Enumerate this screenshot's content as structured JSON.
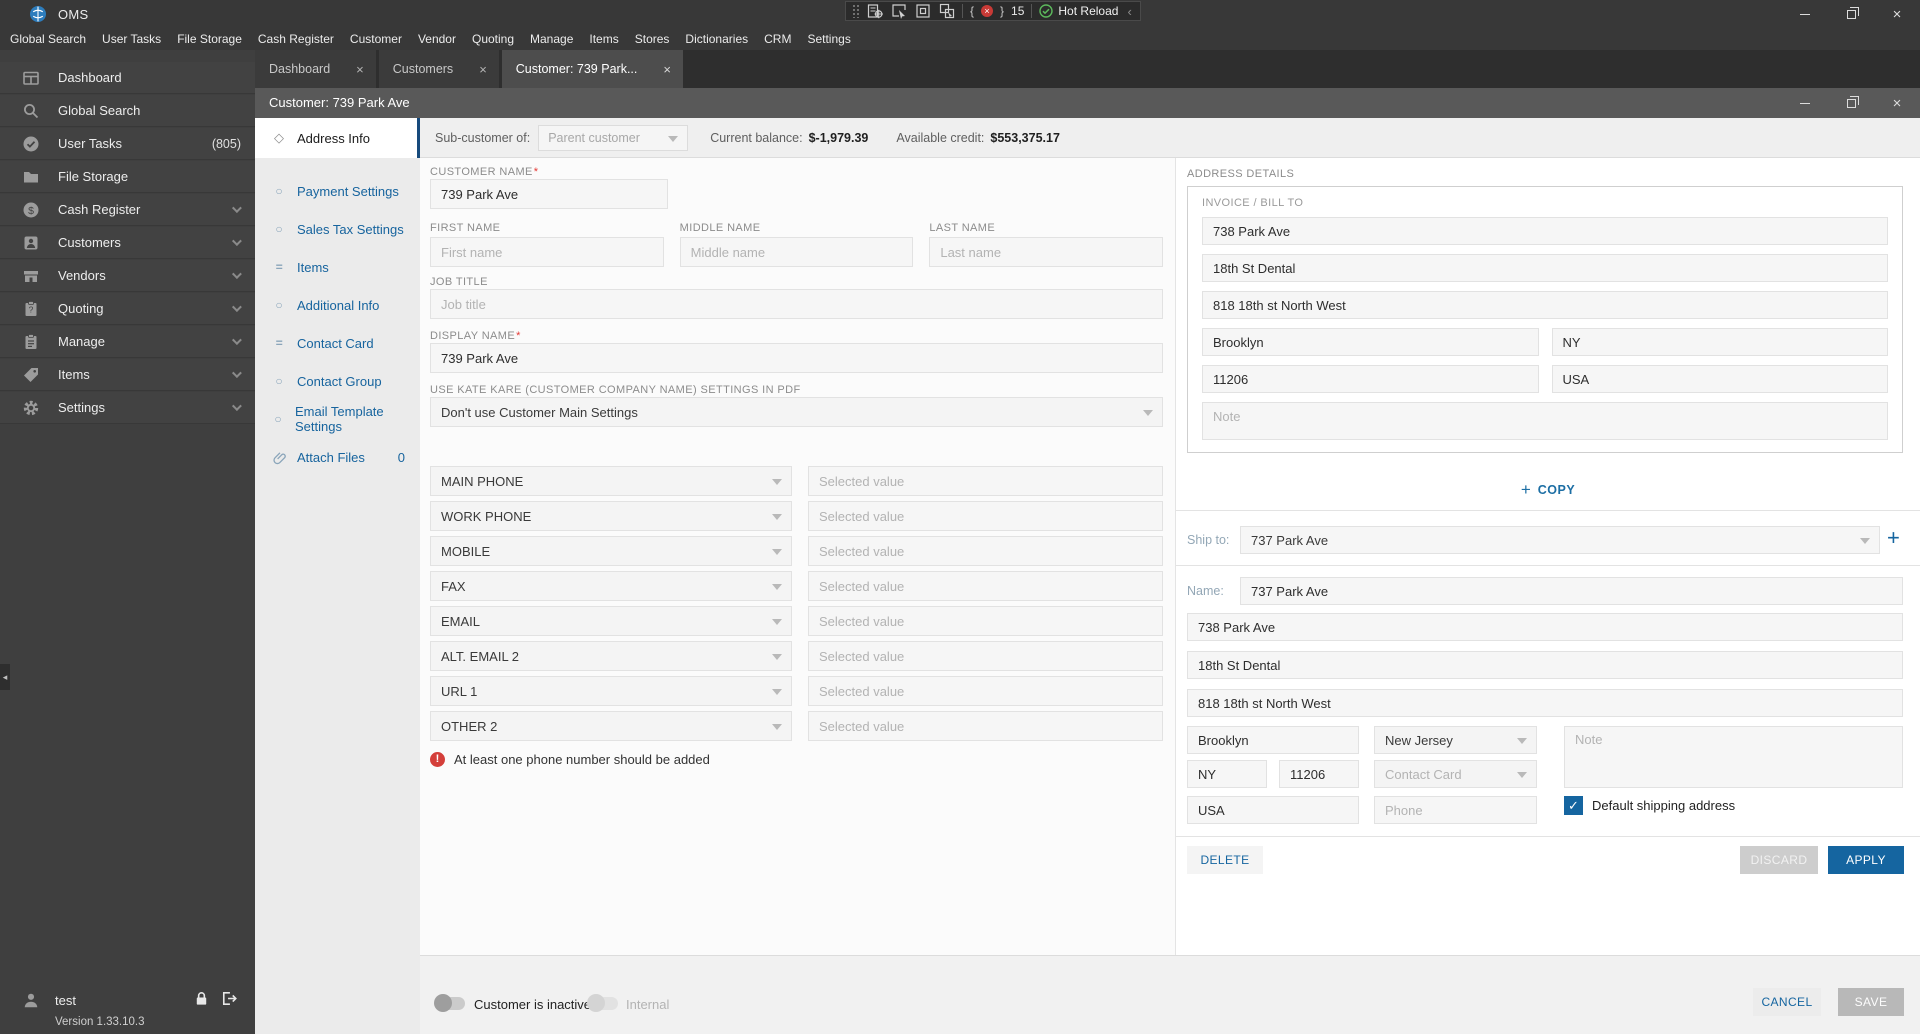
{
  "app": {
    "name": "OMS"
  },
  "debug_overlay": {
    "binding_count": "15",
    "hot_reload_label": "Hot Reload"
  },
  "menubar": {
    "items": [
      "Global Search",
      "User Tasks",
      "File Storage",
      "Cash Register",
      "Customer",
      "Vendor",
      "Quoting",
      "Manage",
      "Items",
      "Stores",
      "Dictionaries",
      "CRM",
      "Settings"
    ]
  },
  "sidebar": {
    "items": [
      {
        "label": "Dashboard"
      },
      {
        "label": "Global Search"
      },
      {
        "label": "User Tasks",
        "badge": "(805)"
      },
      {
        "label": "File Storage"
      },
      {
        "label": "Cash Register"
      },
      {
        "label": "Customers"
      },
      {
        "label": "Vendors"
      },
      {
        "label": "Quoting"
      },
      {
        "label": "Manage"
      },
      {
        "label": "Items"
      },
      {
        "label": "Settings"
      }
    ],
    "user": "test",
    "version": "Version 1.33.10.3"
  },
  "tabs": {
    "items": [
      {
        "label": "Dashboard"
      },
      {
        "label": "Customers"
      },
      {
        "label": "Customer: 739 Park..."
      }
    ]
  },
  "window": {
    "title": "Customer: 739 Park Ave"
  },
  "subheader": {
    "sub_customer_label": "Sub-customer of:",
    "sub_customer_value": "Parent customer",
    "balance_label": "Current balance:",
    "balance_value": "$-1,979.39",
    "credit_label": "Available credit:",
    "credit_value": "$553,375.17"
  },
  "nav": {
    "items": [
      {
        "label": "Address Info"
      },
      {
        "label": "Payment Settings"
      },
      {
        "label": "Sales Tax Settings"
      },
      {
        "label": "Items"
      },
      {
        "label": "Additional Info"
      },
      {
        "label": "Contact Card"
      },
      {
        "label": "Contact Group"
      },
      {
        "label": "Email Template Settings"
      },
      {
        "label": "Attach Files",
        "count": "0"
      }
    ]
  },
  "form": {
    "required_marker": "*",
    "customer_name_label": "CUSTOMER NAME",
    "customer_name_value": "739 Park Ave",
    "first_name_label": "FIRST NAME",
    "first_name_placeholder": "First name",
    "middle_name_label": "MIDDLE NAME",
    "middle_name_placeholder": "Middle name",
    "last_name_label": "LAST NAME",
    "last_name_placeholder": "Last name",
    "job_title_label": "JOB TITLE",
    "job_title_placeholder": "Job title",
    "display_name_label": "DISPLAY NAME",
    "display_name_value": "739 Park Ave",
    "pdf_settings_label": "USE KATE KARE (CUSTOMER COMPANY NAME) SETTINGS IN PDF",
    "pdf_settings_value": "Don't use Customer Main Settings"
  },
  "phones": {
    "rows": [
      "MAIN PHONE",
      "WORK PHONE",
      "MOBILE",
      "FAX",
      "EMAIL",
      "ALT. EMAIL 2",
      "URL 1",
      "OTHER 2"
    ],
    "value_placeholder": "Selected value",
    "warning": "At least one phone number should be added"
  },
  "address": {
    "heading": "ADDRESS DETAILS",
    "bill_to": {
      "label": "INVOICE / BILL TO",
      "line1": "738 Park Ave",
      "line2": "18th St Dental",
      "line3": "818 18th st North West",
      "city": "Brooklyn",
      "state": "NY",
      "zip": "11206",
      "country": "USA",
      "note_placeholder": "Note"
    },
    "copy_label": "COPY",
    "copy_plus": "+",
    "ship_to_label": "Ship to:",
    "ship_to_selected": "737 Park Ave",
    "ship_add_plus": "+",
    "ship": {
      "name_label": "Name:",
      "name_value": "737 Park Ave",
      "line1": "738 Park Ave",
      "line2": "18th St Dental",
      "line3": "818 18th st North West",
      "city": "Brooklyn",
      "state_select": "New Jersey",
      "note_placeholder": "Note",
      "state": "NY",
      "zip": "11206",
      "contact_card_placeholder": "Contact Card",
      "country": "USA",
      "phone_placeholder": "Phone",
      "default_label": "Default shipping address"
    },
    "buttons": {
      "delete": "DELETE",
      "discard": "DISCARD",
      "apply": "APPLY"
    }
  },
  "footer": {
    "inactive_label": "Customer is inactive",
    "internal_label": "Internal",
    "cancel": "CANCEL",
    "save": "SAVE"
  }
}
